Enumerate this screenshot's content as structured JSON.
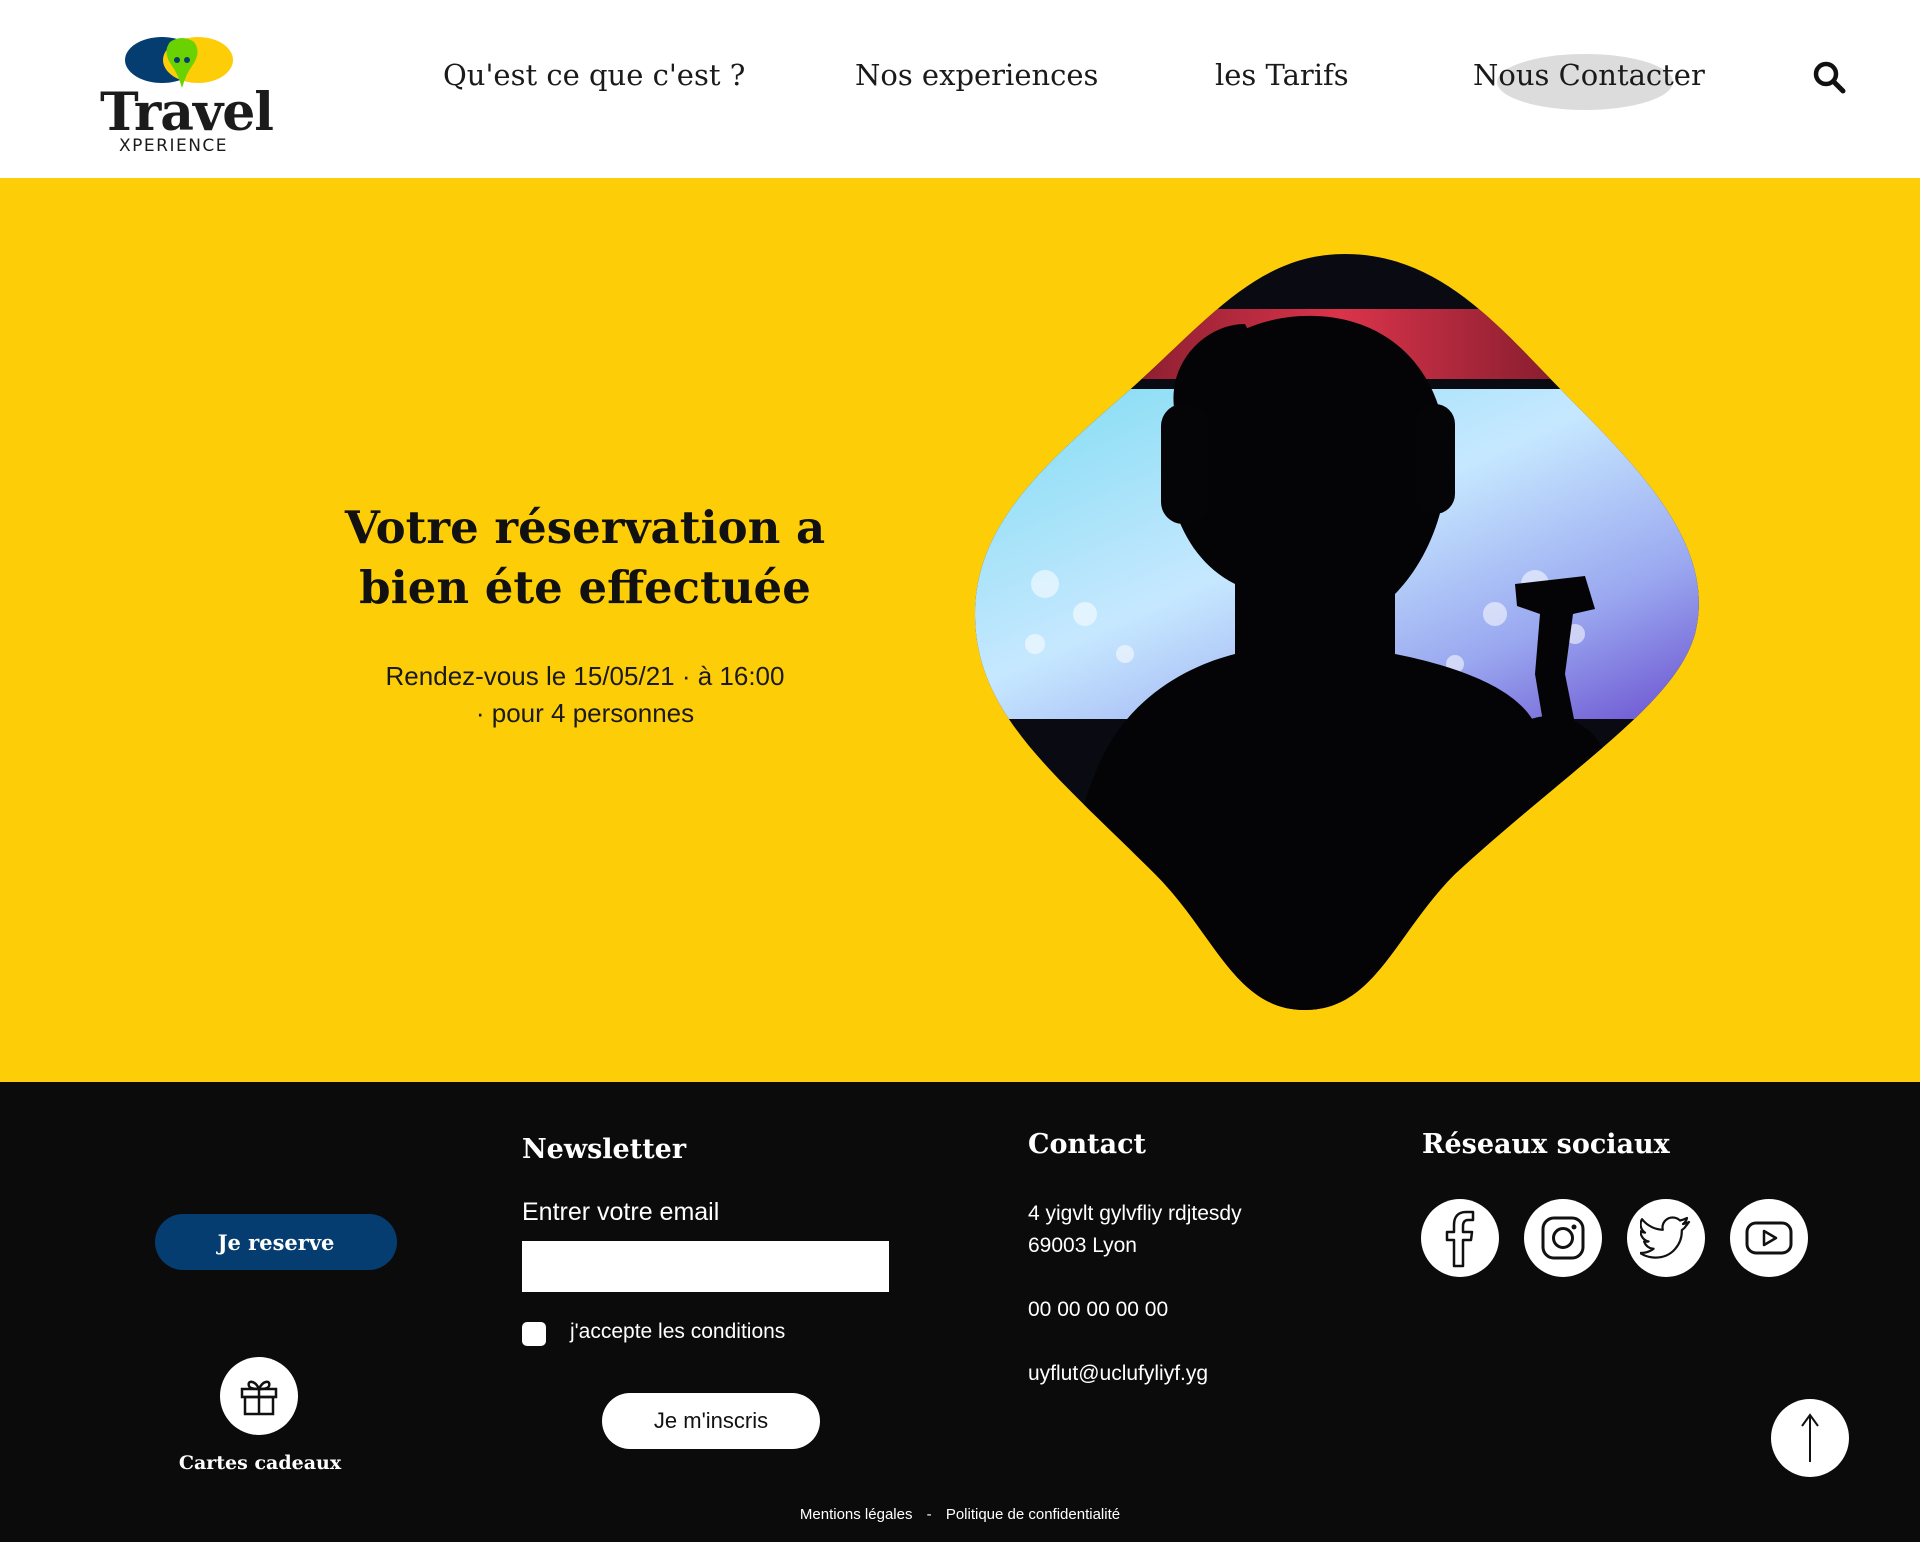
{
  "brand": {
    "name": "Travel",
    "subtitle": "XPERIENCE",
    "colors": {
      "blue": "#053d70",
      "yellow": "#fdcd08",
      "green": "#6ad200"
    }
  },
  "nav": {
    "items": [
      {
        "label": "Qu'est ce que c'est ?"
      },
      {
        "label": "Nos experiences"
      },
      {
        "label": "les Tarifs"
      },
      {
        "label": "Nous Contacter"
      }
    ],
    "active": "Nous Contacter",
    "search_icon": "search-icon"
  },
  "hero": {
    "title_line1": "Votre réservation a",
    "title_line2": "bien éte effectuée",
    "info_line1": "Rendez-vous le 15/05/21 · à 16:00",
    "info_line2": "· pour 4 personnes",
    "image_subject": "vr-gamer-silhouette",
    "background_color": "#fdcd08"
  },
  "footer": {
    "reserve_button": "Je reserve",
    "gift_label": "Cartes cadeaux",
    "newsletter": {
      "title": "Newsletter",
      "email_label": "Entrer votre email",
      "email_value": "",
      "email_placeholder": "",
      "conditions_label": "j'accepte les conditions",
      "conditions_checked": false,
      "subscribe_button": "Je m'inscris"
    },
    "contact": {
      "title": "Contact",
      "address_line1": "4 yigvlt gylvfliy rdjtesdy",
      "address_line2": "69003 Lyon",
      "phone": "00 00 00 00 00",
      "email": "uyflut@uclufyliyf.yg"
    },
    "social": {
      "title": "Réseaux sociaux",
      "networks": [
        "facebook-icon",
        "instagram-icon",
        "twitter-icon",
        "youtube-icon"
      ]
    },
    "legal": {
      "mentions": "Mentions légales",
      "separator": "-",
      "privacy": "Politique de confidentialité"
    }
  }
}
